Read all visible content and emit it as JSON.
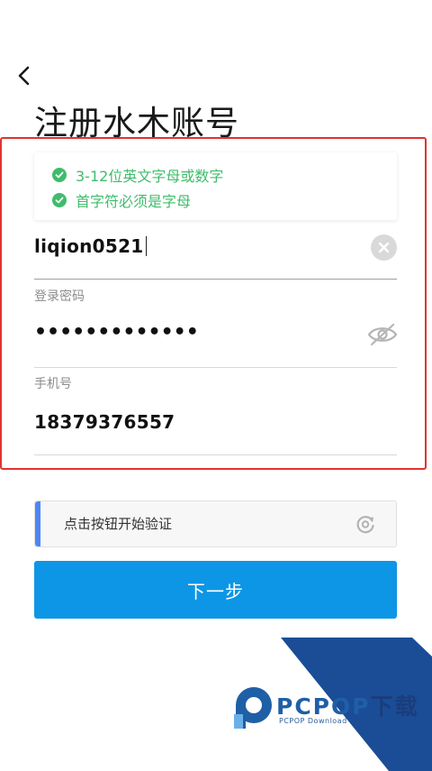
{
  "header": {
    "title": "注册水木账号"
  },
  "hints": [
    {
      "text": "3-12位英文字母或数字"
    },
    {
      "text": "首字符必须是字母"
    }
  ],
  "username": {
    "value": "liqion0521"
  },
  "password": {
    "label": "登录密码",
    "masked_value": "•••••••••••••"
  },
  "phone": {
    "label": "手机号",
    "value": "18379376557"
  },
  "verify": {
    "label": "点击按钮开始验证"
  },
  "actions": {
    "next_label": "下一步"
  },
  "watermark": {
    "brand_main": "PCPOP",
    "brand_suffix": "下载",
    "subtitle": "PCPOP Download"
  },
  "colors": {
    "accent_blue": "#0d96e5",
    "success_green": "#3fbc6b",
    "highlight_red": "#e0332f",
    "verify_accent": "#4f86f7",
    "watermark_blue": "#1f5fa6"
  },
  "icons": {
    "back": "chevron-left-icon",
    "hint_check": "check-circle-icon",
    "clear": "close-circle-icon",
    "password_visibility": "eye-off-icon",
    "verify": "refresh-captcha-icon",
    "watermark_logo": "pcpop-logo-icon"
  }
}
